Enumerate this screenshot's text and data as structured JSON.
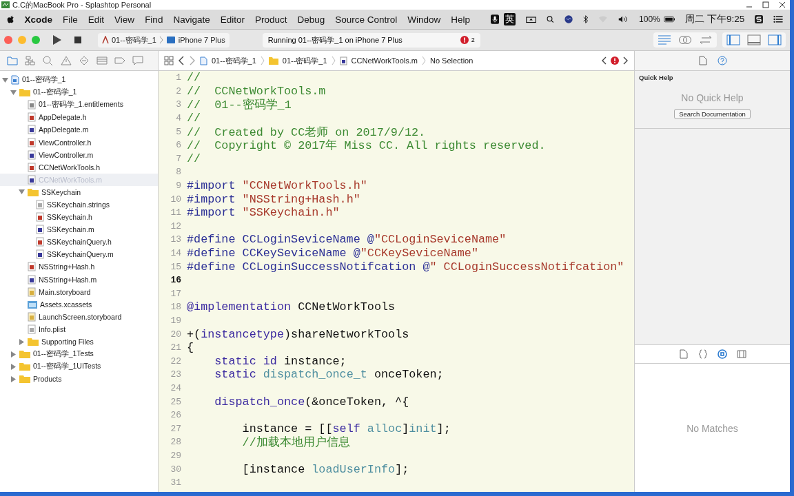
{
  "window": {
    "title": "C.C的MacBook Pro - Splashtop Personal"
  },
  "menu_bar": {
    "app": "Xcode",
    "items": [
      "File",
      "Edit",
      "View",
      "Find",
      "Navigate",
      "Editor",
      "Product",
      "Debug",
      "Source Control",
      "Window",
      "Help"
    ],
    "input_method": "英",
    "battery": "100%",
    "clock": "周二 下午9:25"
  },
  "toolbar": {
    "scheme": "01--密码学_1",
    "device": "iPhone 7 Plus",
    "activity": "Running 01--密码学_1 on iPhone 7 Plus",
    "error_count": "2"
  },
  "navigator_tabs": [
    {
      "kind": "folder",
      "selected": true
    },
    {
      "kind": "symbol",
      "selected": false
    },
    {
      "kind": "search",
      "selected": false
    },
    {
      "kind": "issue",
      "selected": false
    },
    {
      "kind": "test",
      "selected": false
    },
    {
      "kind": "debug",
      "selected": false
    },
    {
      "kind": "breakpoint",
      "selected": false
    },
    {
      "kind": "report",
      "selected": false
    }
  ],
  "breadcrumbs": [
    "01--密码学_1",
    "01--密码学_1",
    "CCNetWorkTools.m",
    "No Selection"
  ],
  "navigator": [
    {
      "name": "01--密码学_1",
      "kind": "project",
      "expanded": true,
      "selected": false,
      "children": [
        {
          "name": "01--密码学_1",
          "kind": "folder",
          "expanded": true,
          "selected": false,
          "children": [
            {
              "name": "01--密码学_1.entitlements",
              "kind": "entitlements",
              "selected": false
            },
            {
              "name": "AppDelegate.h",
              "kind": "h",
              "selected": false
            },
            {
              "name": "AppDelegate.m",
              "kind": "m",
              "selected": false
            },
            {
              "name": "ViewController.h",
              "kind": "h",
              "selected": false
            },
            {
              "name": "ViewController.m",
              "kind": "m",
              "selected": false
            },
            {
              "name": "CCNetWorkTools.h",
              "kind": "h",
              "selected": false
            },
            {
              "name": "CCNetWorkTools.m",
              "kind": "m",
              "selected": true
            },
            {
              "name": "SSKeychain",
              "kind": "folder",
              "expanded": true,
              "selected": false,
              "children": [
                {
                  "name": "SSKeychain.strings",
                  "kind": "strings",
                  "selected": false
                },
                {
                  "name": "SSKeychain.h",
                  "kind": "h",
                  "selected": false
                },
                {
                  "name": "SSKeychain.m",
                  "kind": "m",
                  "selected": false
                },
                {
                  "name": "SSKeychainQuery.h",
                  "kind": "h",
                  "selected": false
                },
                {
                  "name": "SSKeychainQuery.m",
                  "kind": "m",
                  "selected": false
                }
              ]
            },
            {
              "name": "NSString+Hash.h",
              "kind": "h",
              "selected": false
            },
            {
              "name": "NSString+Hash.m",
              "kind": "m",
              "selected": false
            },
            {
              "name": "Main.storyboard",
              "kind": "storyboard",
              "selected": false
            },
            {
              "name": "Assets.xcassets",
              "kind": "xcassets",
              "selected": false
            },
            {
              "name": "LaunchScreen.storyboard",
              "kind": "storyboard",
              "selected": false
            },
            {
              "name": "Info.plist",
              "kind": "plist",
              "selected": false
            },
            {
              "name": "Supporting Files",
              "kind": "folder",
              "expanded": false,
              "selected": false
            }
          ]
        },
        {
          "name": "01--密码学_1Tests",
          "kind": "folder",
          "expanded": false,
          "selected": false
        },
        {
          "name": "01--密码学_1UITests",
          "kind": "folder",
          "expanded": false,
          "selected": false
        },
        {
          "name": "Products",
          "kind": "folder",
          "expanded": false,
          "selected": false
        }
      ]
    }
  ],
  "code_lines": [
    {
      "number": "1",
      "current": false,
      "tokens": [
        {
          "kind": "comment",
          "text": "//"
        }
      ]
    },
    {
      "number": "2",
      "current": false,
      "tokens": [
        {
          "kind": "comment",
          "text": "//  CCNetWorkTools.m"
        }
      ]
    },
    {
      "number": "3",
      "current": false,
      "tokens": [
        {
          "kind": "comment",
          "text": "//  01--密码学_1"
        }
      ]
    },
    {
      "number": "4",
      "current": false,
      "tokens": [
        {
          "kind": "comment",
          "text": "//"
        }
      ]
    },
    {
      "number": "5",
      "current": false,
      "tokens": [
        {
          "kind": "comment",
          "text": "//  Created by CC老师 on 2017/9/12."
        }
      ]
    },
    {
      "number": "6",
      "current": false,
      "tokens": [
        {
          "kind": "comment",
          "text": "//  Copyright © 2017年 Miss CC. All rights reserved."
        }
      ]
    },
    {
      "number": "7",
      "current": false,
      "tokens": [
        {
          "kind": "comment",
          "text": "//"
        }
      ]
    },
    {
      "number": "8",
      "current": false
    },
    {
      "number": "9",
      "current": false,
      "tokens": [
        {
          "kind": "directive",
          "text": "#import "
        },
        {
          "kind": "string",
          "text": "\"CCNetWorkTools.h\""
        }
      ]
    },
    {
      "number": "10",
      "current": false,
      "tokens": [
        {
          "kind": "directive",
          "text": "#import "
        },
        {
          "kind": "string",
          "text": "\"NSString+Hash.h\""
        }
      ]
    },
    {
      "number": "11",
      "current": false,
      "tokens": [
        {
          "kind": "directive",
          "text": "#import "
        },
        {
          "kind": "string",
          "text": "\"SSKeychain.h\""
        }
      ]
    },
    {
      "number": "12",
      "current": false
    },
    {
      "number": "13",
      "current": false,
      "tokens": [
        {
          "kind": "directive",
          "text": "#define CCLoginSeviceName @"
        },
        {
          "kind": "string",
          "text": "\"CCLoginSeviceName\""
        }
      ]
    },
    {
      "number": "14",
      "current": false,
      "tokens": [
        {
          "kind": "directive",
          "text": "#define CCKeySeviceName @"
        },
        {
          "kind": "string",
          "text": "\"CCKeySeviceName\""
        }
      ]
    },
    {
      "number": "15",
      "current": false,
      "tokens": [
        {
          "kind": "directive",
          "text": "#define CCLoginSuccessNotifcation @"
        },
        {
          "kind": "string",
          "text": "\" CCLoginSuccessNotifcation\""
        }
      ]
    },
    {
      "number": "16",
      "current": true
    },
    {
      "number": "17",
      "current": false
    },
    {
      "number": "18",
      "current": false,
      "tokens": [
        {
          "kind": "keyword",
          "text": "@implementation"
        },
        {
          "kind": "plain",
          "text": " CCNetWorkTools"
        }
      ]
    },
    {
      "number": "19",
      "current": false
    },
    {
      "number": "20",
      "current": false,
      "tokens": [
        {
          "kind": "plain",
          "text": "+("
        },
        {
          "kind": "keyword",
          "text": "instancetype"
        },
        {
          "kind": "plain",
          "text": ")shareNetworkTools"
        }
      ]
    },
    {
      "number": "21",
      "current": false,
      "tokens": [
        {
          "kind": "plain",
          "text": "{"
        }
      ]
    },
    {
      "number": "22",
      "current": false,
      "tokens": [
        {
          "kind": "keyword",
          "text": "    static"
        },
        {
          "kind": "keyword",
          "text": " id"
        },
        {
          "kind": "plain",
          "text": " instance;"
        }
      ]
    },
    {
      "number": "23",
      "current": false,
      "tokens": [
        {
          "kind": "keyword",
          "text": "    static"
        },
        {
          "kind": "type",
          "text": " dispatch_once_t"
        },
        {
          "kind": "plain",
          "text": " onceToken;"
        }
      ]
    },
    {
      "number": "24",
      "current": false
    },
    {
      "number": "25",
      "current": false,
      "tokens": [
        {
          "kind": "keyword",
          "text": "    dispatch_once"
        },
        {
          "kind": "plain",
          "text": "(&onceToken, ^{"
        }
      ]
    },
    {
      "number": "26",
      "current": false
    },
    {
      "number": "27",
      "current": false,
      "tokens": [
        {
          "kind": "plain",
          "text": "        instance = [["
        },
        {
          "kind": "keyword",
          "text": "self"
        },
        {
          "kind": "type",
          "text": " alloc"
        },
        {
          "kind": "plain",
          "text": "]"
        },
        {
          "kind": "type",
          "text": "init"
        },
        {
          "kind": "plain",
          "text": "];"
        }
      ]
    },
    {
      "number": "28",
      "current": false,
      "tokens": [
        {
          "kind": "comment",
          "text": "        //加载本地用户信息"
        }
      ]
    },
    {
      "number": "29",
      "current": false
    },
    {
      "number": "30",
      "current": false,
      "tokens": [
        {
          "kind": "plain",
          "text": "        [instance "
        },
        {
          "kind": "type",
          "text": "loadUserInfo"
        },
        {
          "kind": "plain",
          "text": "];"
        }
      ]
    },
    {
      "number": "31",
      "current": false
    }
  ],
  "inspector": {
    "tabs": [
      {
        "kind": "file",
        "selected": false
      },
      {
        "kind": "help",
        "selected": true
      }
    ],
    "title": "Quick Help",
    "empty_text": "No Quick Help",
    "button": "Search Documentation"
  },
  "library": {
    "tabs": [
      {
        "kind": "file",
        "selected": false
      },
      {
        "kind": "code",
        "selected": false
      },
      {
        "kind": "object",
        "selected": true
      },
      {
        "kind": "media",
        "selected": false
      }
    ],
    "empty_text": "No Matches"
  }
}
